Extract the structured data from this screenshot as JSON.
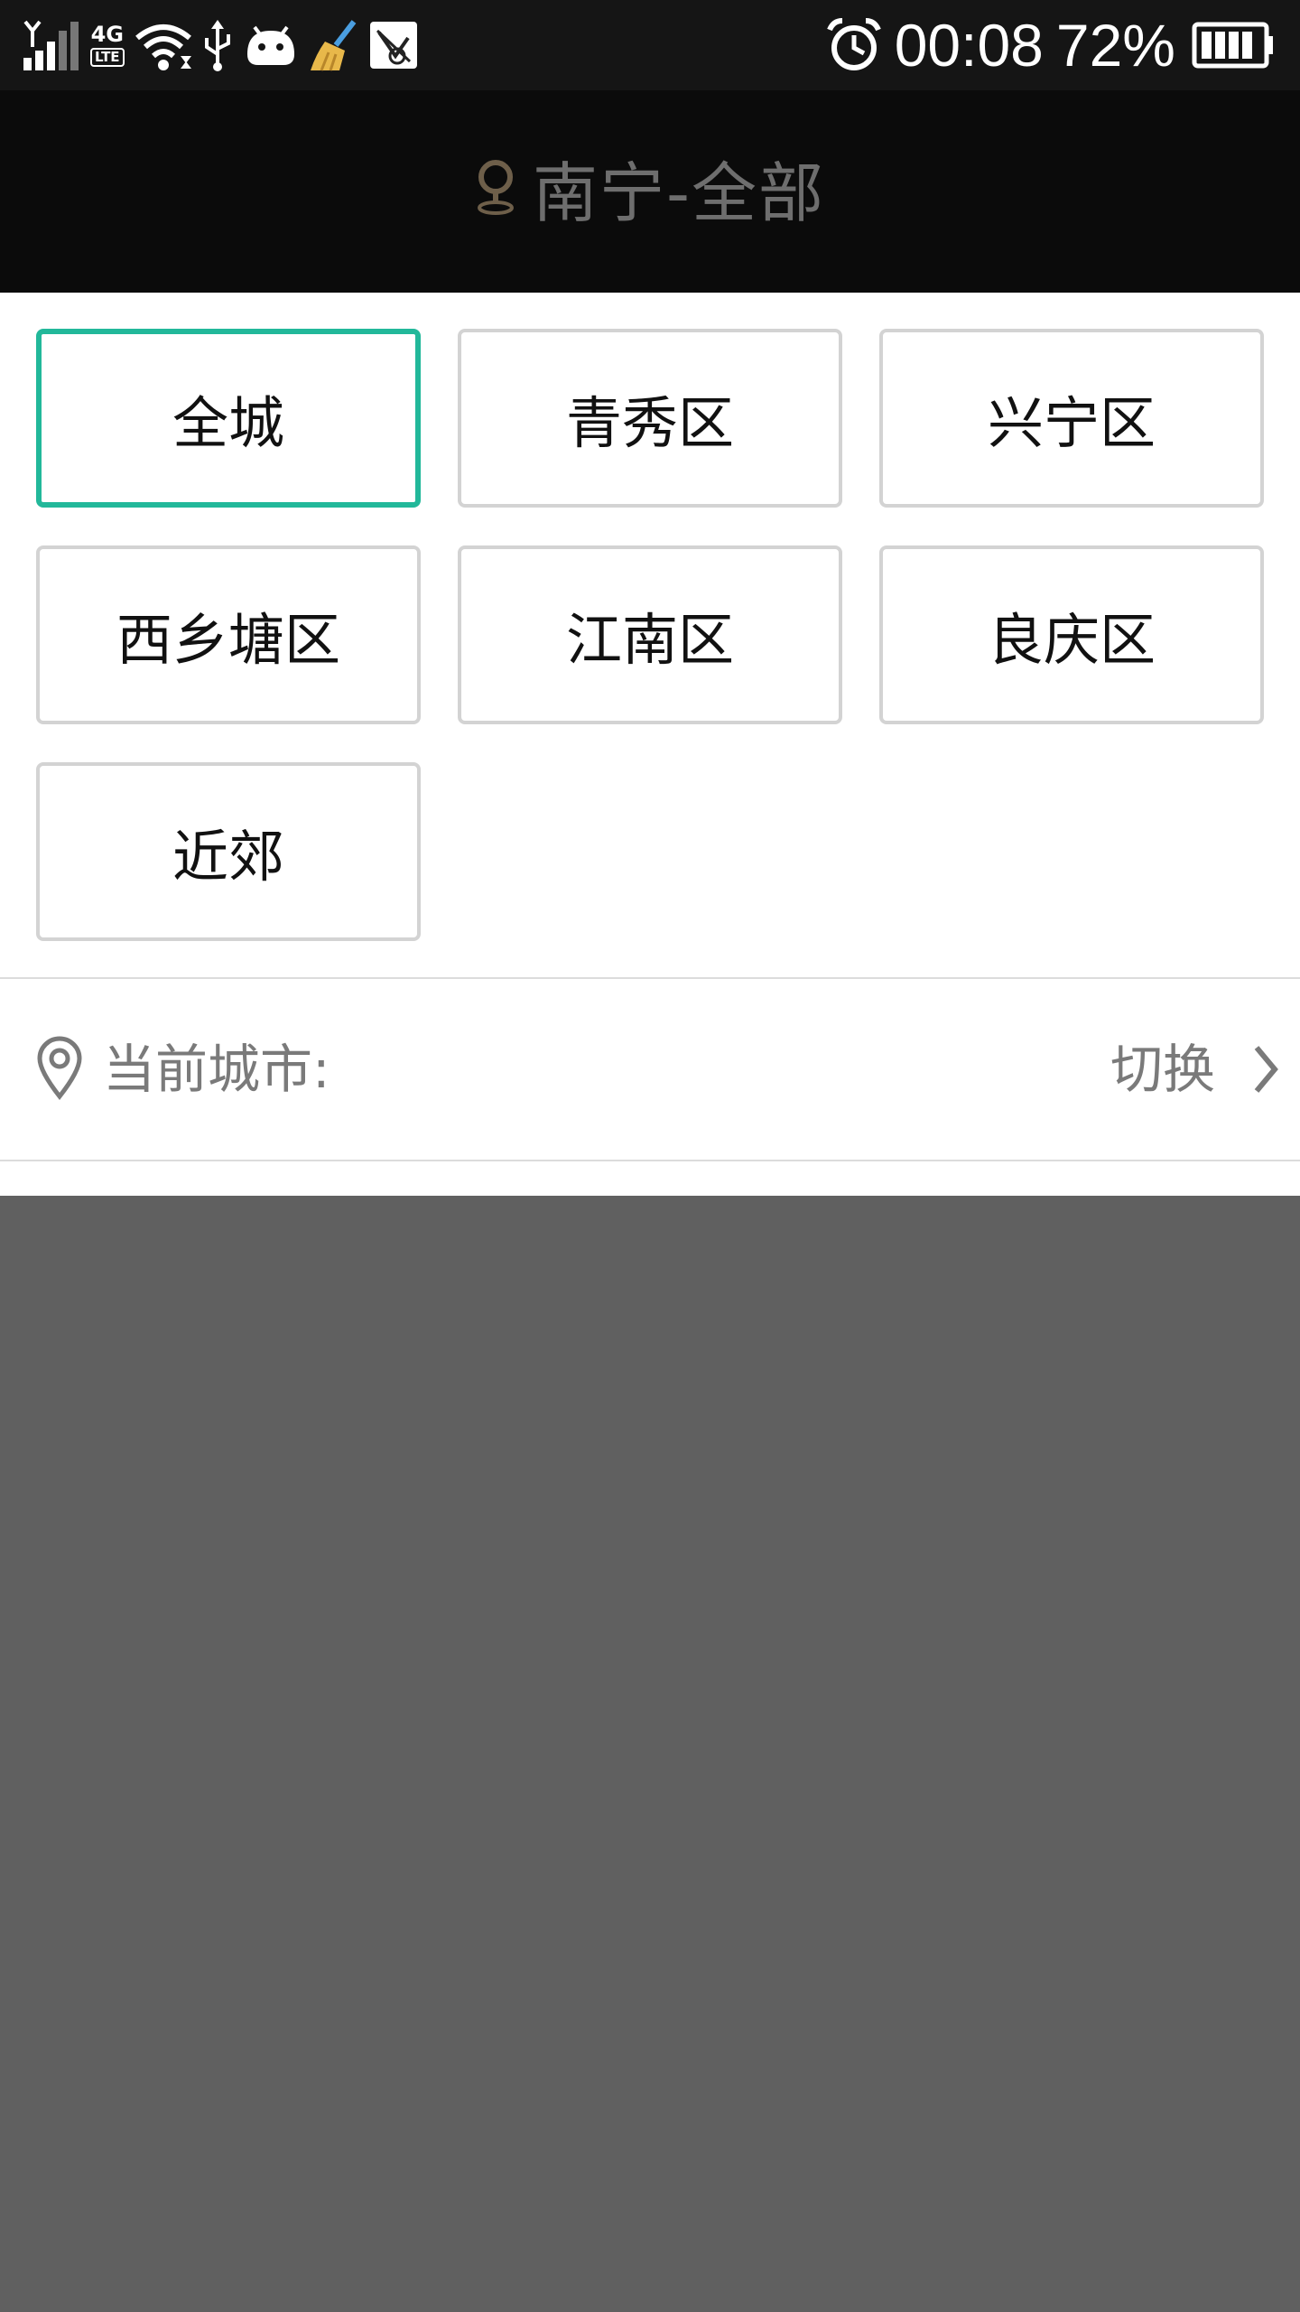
{
  "status_bar": {
    "network_type": "4G",
    "network_sub": "LTE",
    "time": "00:08",
    "battery_percent": "72%"
  },
  "header": {
    "title": "南宁-全部"
  },
  "districts": {
    "items": [
      {
        "label": "全城",
        "selected": true
      },
      {
        "label": "青秀区",
        "selected": false
      },
      {
        "label": "兴宁区",
        "selected": false
      },
      {
        "label": "西乡塘区",
        "selected": false
      },
      {
        "label": "江南区",
        "selected": false
      },
      {
        "label": "良庆区",
        "selected": false
      },
      {
        "label": "近郊",
        "selected": false
      }
    ]
  },
  "current_city": {
    "label": "当前城市:",
    "switch_label": "切换"
  },
  "colors": {
    "accent": "#22b89a",
    "overlay": "#606060",
    "title_bar": "#0b0b0b"
  }
}
